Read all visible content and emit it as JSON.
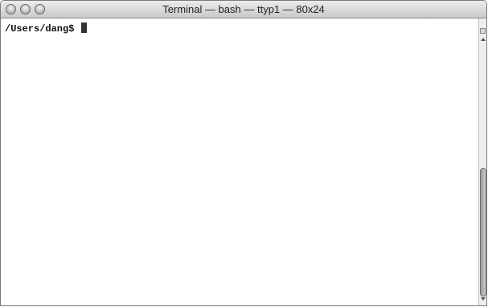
{
  "window": {
    "title": "Terminal — bash — ttyp1 — 80x24"
  },
  "terminal": {
    "prompt": "/Users/dang$ "
  },
  "icons": {
    "close": "close-icon",
    "minimize": "minimize-icon",
    "zoom": "zoom-icon",
    "cursor": "cursor-block"
  }
}
